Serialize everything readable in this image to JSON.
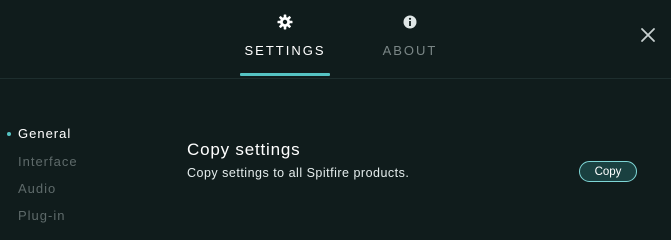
{
  "tabs": [
    {
      "label": "SETTINGS",
      "icon": "gear-icon",
      "active": true
    },
    {
      "label": "ABOUT",
      "icon": "info-icon",
      "active": false
    }
  ],
  "close_icon": "close-icon",
  "sidebar": {
    "items": [
      {
        "label": "General",
        "active": true
      },
      {
        "label": "Interface",
        "active": false
      },
      {
        "label": "Audio",
        "active": false
      },
      {
        "label": "Plug-in",
        "active": false
      }
    ]
  },
  "section": {
    "title": "Copy settings",
    "description": "Copy settings to all Spitfire products.",
    "button_label": "Copy"
  },
  "colors": {
    "background": "#101c1c",
    "accent": "#55c3c3",
    "inactive_text": "#5e6a6a"
  }
}
